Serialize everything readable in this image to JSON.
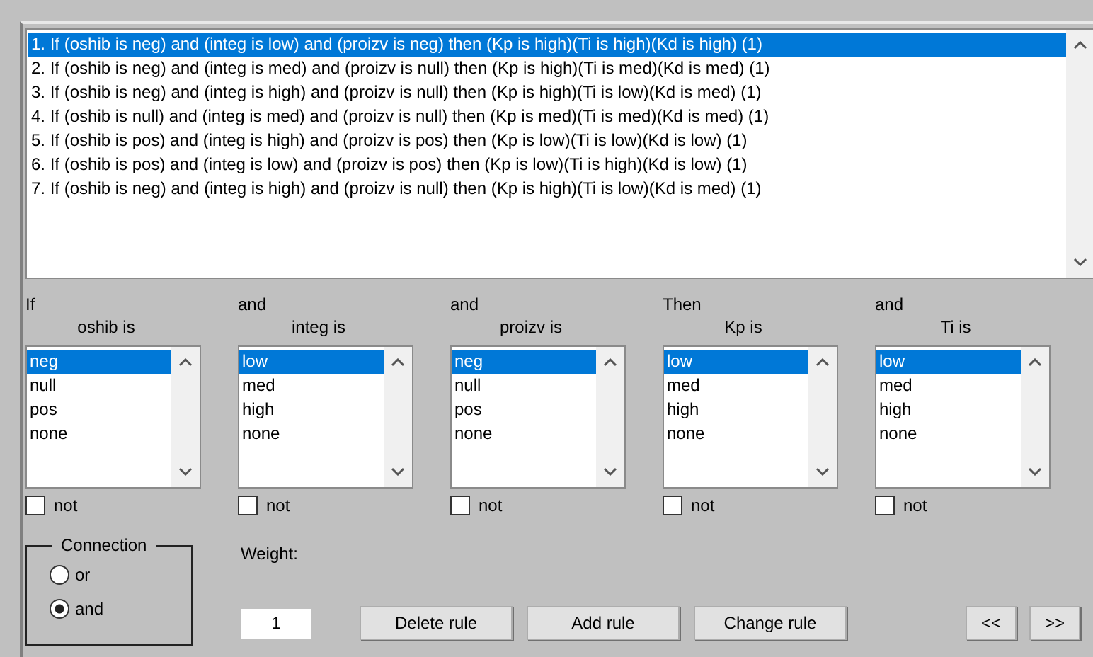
{
  "rules": [
    {
      "text": "1. If (oshib is neg) and (integ is low) and (proizv is neg) then (Kp is high)(Ti is high)(Kd is high) (1)",
      "selected": true
    },
    {
      "text": "2. If (oshib is neg) and (integ is med) and (proizv is null) then (Kp is high)(Ti is med)(Kd is med) (1)",
      "selected": false
    },
    {
      "text": "3. If (oshib is neg) and (integ is high) and (proizv is null) then (Kp is high)(Ti is low)(Kd is med) (1)",
      "selected": false
    },
    {
      "text": "4. If (oshib is null) and (integ is med) and (proizv is null) then (Kp is med)(Ti is med)(Kd is med) (1)",
      "selected": false
    },
    {
      "text": "5. If (oshib is pos) and (integ is high) and (proizv is pos) then (Kp is low)(Ti is low)(Kd is low) (1)",
      "selected": false
    },
    {
      "text": "6. If (oshib is pos) and (integ is low) and (proizv is pos) then (Kp is low)(Ti is high)(Kd is low) (1)",
      "selected": false
    },
    {
      "text": "7. If (oshib is neg) and (integ is high) and (proizv is null) then (Kp is high)(Ti is low)(Kd is med) (1)",
      "selected": false
    }
  ],
  "variables": [
    {
      "connective": "If",
      "label": "oshib is",
      "options": [
        {
          "label": "neg",
          "selected": true
        },
        {
          "label": "null",
          "selected": false
        },
        {
          "label": "pos",
          "selected": false
        },
        {
          "label": "none",
          "selected": false
        }
      ],
      "not_label": "not",
      "not_checked": false
    },
    {
      "connective": "and",
      "label": "integ is",
      "options": [
        {
          "label": "low",
          "selected": true
        },
        {
          "label": "med",
          "selected": false
        },
        {
          "label": "high",
          "selected": false
        },
        {
          "label": "none",
          "selected": false
        }
      ],
      "not_label": "not",
      "not_checked": false
    },
    {
      "connective": "and",
      "label": "proizv is",
      "options": [
        {
          "label": "neg",
          "selected": true
        },
        {
          "label": "null",
          "selected": false
        },
        {
          "label": "pos",
          "selected": false
        },
        {
          "label": "none",
          "selected": false
        }
      ],
      "not_label": "not",
      "not_checked": false
    },
    {
      "connective": "Then",
      "label": "Kp is",
      "options": [
        {
          "label": "low",
          "selected": true
        },
        {
          "label": "med",
          "selected": false
        },
        {
          "label": "high",
          "selected": false
        },
        {
          "label": "none",
          "selected": false
        }
      ],
      "not_label": "not",
      "not_checked": false
    },
    {
      "connective": "and",
      "label": "Ti is",
      "options": [
        {
          "label": "low",
          "selected": true
        },
        {
          "label": "med",
          "selected": false
        },
        {
          "label": "high",
          "selected": false
        },
        {
          "label": "none",
          "selected": false
        }
      ],
      "not_label": "not",
      "not_checked": false
    }
  ],
  "connection": {
    "title": "Connection",
    "options": [
      {
        "label": "or",
        "selected": false
      },
      {
        "label": "and",
        "selected": true
      }
    ]
  },
  "weight": {
    "label": "Weight:",
    "value": "1"
  },
  "buttons": [
    "Delete rule",
    "Add rule",
    "Change rule"
  ],
  "nav_buttons": [
    "<<",
    ">>"
  ]
}
